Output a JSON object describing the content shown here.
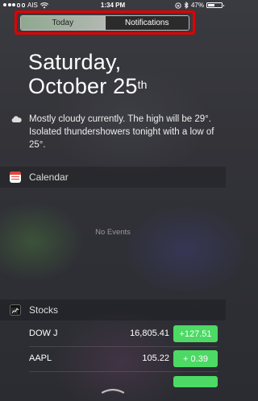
{
  "status_bar": {
    "carrier": "AIS",
    "time": "1:34 PM",
    "battery": "47%",
    "battery_level": 0.47
  },
  "tabs": [
    {
      "label": "Today",
      "active": true
    },
    {
      "label": "Notifications",
      "active": false
    }
  ],
  "header": {
    "date_line1": "Saturday,",
    "date_line2": "October 25",
    "date_suffix": "th"
  },
  "weather": {
    "icon": "cloud-icon",
    "text": "Mostly cloudy currently. The high will be 29°. Isolated thundershowers tonight with a low of 25°."
  },
  "calendar": {
    "title": "Calendar",
    "icon": "calendar-icon",
    "empty_text": "No Events"
  },
  "stocks": {
    "title": "Stocks",
    "icon": "stocks-icon",
    "rows": [
      {
        "symbol": "DOW J",
        "price": "16,805.41",
        "change": "+127.51"
      },
      {
        "symbol": "AAPL",
        "price": "105.22",
        "change": "+ 0.39"
      }
    ]
  },
  "colors": {
    "highlight": "#e00000",
    "positive": "#4cd964",
    "calendar_red": "#e0463e"
  }
}
